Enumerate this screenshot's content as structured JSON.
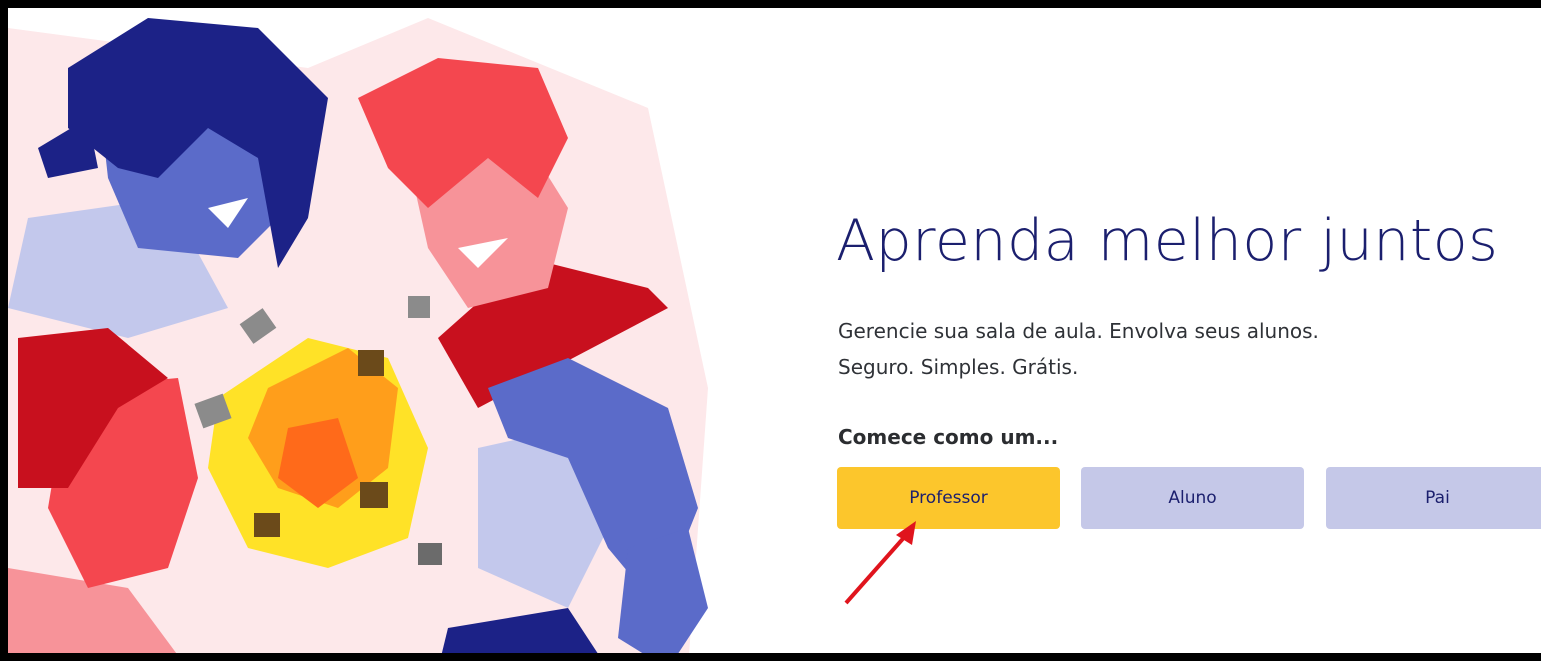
{
  "hero": {
    "title": "Aprenda melhor juntos",
    "tagline_line1": "Gerencie sua sala de aula. Envolva seus alunos.",
    "tagline_line2": "Seguro. Simples. Grátis."
  },
  "signup": {
    "prompt": "Comece como um...",
    "roles": [
      {
        "label": "Professor"
      },
      {
        "label": "Aluno"
      },
      {
        "label": "Pai"
      }
    ]
  },
  "colors": {
    "title": "#1b1f6e",
    "primary_button": "#fcc62c",
    "secondary_button": "#c5c8e8",
    "annotation_arrow": "#e0141d"
  },
  "annotation": {
    "icon": "red-arrow-icon",
    "points_to": "Professor"
  }
}
